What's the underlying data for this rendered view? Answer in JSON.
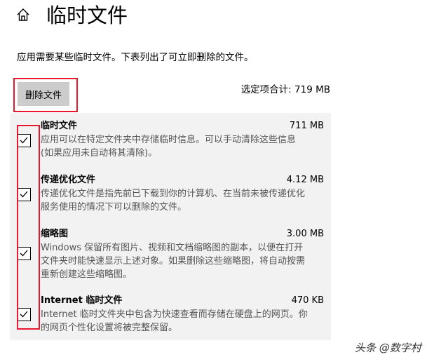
{
  "header": {
    "title": "临时文件",
    "home_icon": "home-icon"
  },
  "description": "应用需要某些临时文件。下表列出了可立即删除的文件。",
  "delete_button_label": "删除文件",
  "total_selected": "选定项合计: 719 MB",
  "items": [
    {
      "name": "临时文件",
      "size": "711 MB",
      "checked": true,
      "desc_lines": [
        "应用可以在特定文件夹中存储临时信息。可以手动清除这些信息",
        "(如果应用未自动将其清除)。"
      ]
    },
    {
      "name": "传递优化文件",
      "size": "4.12 MB",
      "checked": true,
      "desc_lines": [
        "传递优化文件是指先前已下载到你的计算机、在当前未被传递优化",
        "服务使用的情况下可以删除的文件。"
      ]
    },
    {
      "name": "缩略图",
      "size": "3.00 MB",
      "checked": true,
      "desc_lines": [
        "Windows 保留所有图片、视频和文档缩略图的副本，以便在打开",
        "文件夹时能快速显示上述对象。如果删除这些缩略图，将自动按需",
        "重新创建这些缩略图。"
      ]
    },
    {
      "name": "Internet 临时文件",
      "size": "470 KB",
      "checked": true,
      "desc_lines": [
        "Internet 临时文件夹中包含为快速查看而存储在硬盘上的网页。你",
        "的网页个性化设置将被完整保留。"
      ]
    }
  ],
  "watermark": "头条 @数字村",
  "colors": {
    "highlight_border": "#e8192c",
    "button_bg": "#cccccc",
    "panel_bg": "#f2f2f2",
    "desc_text": "#555555"
  }
}
